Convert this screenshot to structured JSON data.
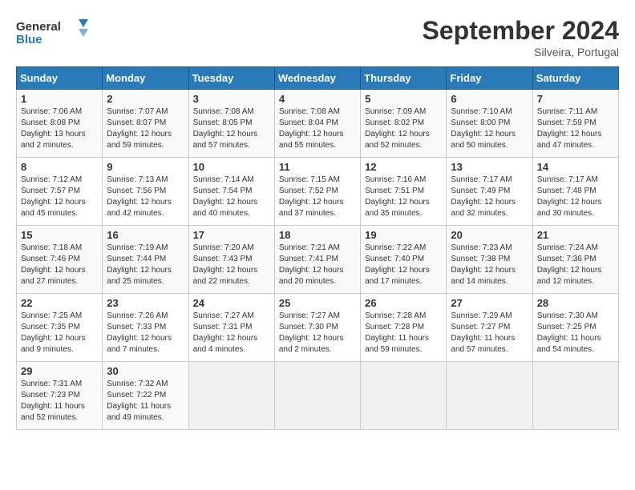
{
  "header": {
    "logo_general": "General",
    "logo_blue": "Blue",
    "month_title": "September 2024",
    "location": "Silveira, Portugal"
  },
  "weekdays": [
    "Sunday",
    "Monday",
    "Tuesday",
    "Wednesday",
    "Thursday",
    "Friday",
    "Saturday"
  ],
  "weeks": [
    [
      {
        "day": "1",
        "sunrise": "7:06 AM",
        "sunset": "8:08 PM",
        "daylight": "13 hours and 2 minutes."
      },
      {
        "day": "2",
        "sunrise": "7:07 AM",
        "sunset": "8:07 PM",
        "daylight": "12 hours and 59 minutes."
      },
      {
        "day": "3",
        "sunrise": "7:08 AM",
        "sunset": "8:05 PM",
        "daylight": "12 hours and 57 minutes."
      },
      {
        "day": "4",
        "sunrise": "7:08 AM",
        "sunset": "8:04 PM",
        "daylight": "12 hours and 55 minutes."
      },
      {
        "day": "5",
        "sunrise": "7:09 AM",
        "sunset": "8:02 PM",
        "daylight": "12 hours and 52 minutes."
      },
      {
        "day": "6",
        "sunrise": "7:10 AM",
        "sunset": "8:00 PM",
        "daylight": "12 hours and 50 minutes."
      },
      {
        "day": "7",
        "sunrise": "7:11 AM",
        "sunset": "7:59 PM",
        "daylight": "12 hours and 47 minutes."
      }
    ],
    [
      {
        "day": "8",
        "sunrise": "7:12 AM",
        "sunset": "7:57 PM",
        "daylight": "12 hours and 45 minutes."
      },
      {
        "day": "9",
        "sunrise": "7:13 AM",
        "sunset": "7:56 PM",
        "daylight": "12 hours and 42 minutes."
      },
      {
        "day": "10",
        "sunrise": "7:14 AM",
        "sunset": "7:54 PM",
        "daylight": "12 hours and 40 minutes."
      },
      {
        "day": "11",
        "sunrise": "7:15 AM",
        "sunset": "7:52 PM",
        "daylight": "12 hours and 37 minutes."
      },
      {
        "day": "12",
        "sunrise": "7:16 AM",
        "sunset": "7:51 PM",
        "daylight": "12 hours and 35 minutes."
      },
      {
        "day": "13",
        "sunrise": "7:17 AM",
        "sunset": "7:49 PM",
        "daylight": "12 hours and 32 minutes."
      },
      {
        "day": "14",
        "sunrise": "7:17 AM",
        "sunset": "7:48 PM",
        "daylight": "12 hours and 30 minutes."
      }
    ],
    [
      {
        "day": "15",
        "sunrise": "7:18 AM",
        "sunset": "7:46 PM",
        "daylight": "12 hours and 27 minutes."
      },
      {
        "day": "16",
        "sunrise": "7:19 AM",
        "sunset": "7:44 PM",
        "daylight": "12 hours and 25 minutes."
      },
      {
        "day": "17",
        "sunrise": "7:20 AM",
        "sunset": "7:43 PM",
        "daylight": "12 hours and 22 minutes."
      },
      {
        "day": "18",
        "sunrise": "7:21 AM",
        "sunset": "7:41 PM",
        "daylight": "12 hours and 20 minutes."
      },
      {
        "day": "19",
        "sunrise": "7:22 AM",
        "sunset": "7:40 PM",
        "daylight": "12 hours and 17 minutes."
      },
      {
        "day": "20",
        "sunrise": "7:23 AM",
        "sunset": "7:38 PM",
        "daylight": "12 hours and 14 minutes."
      },
      {
        "day": "21",
        "sunrise": "7:24 AM",
        "sunset": "7:36 PM",
        "daylight": "12 hours and 12 minutes."
      }
    ],
    [
      {
        "day": "22",
        "sunrise": "7:25 AM",
        "sunset": "7:35 PM",
        "daylight": "12 hours and 9 minutes."
      },
      {
        "day": "23",
        "sunrise": "7:26 AM",
        "sunset": "7:33 PM",
        "daylight": "12 hours and 7 minutes."
      },
      {
        "day": "24",
        "sunrise": "7:27 AM",
        "sunset": "7:31 PM",
        "daylight": "12 hours and 4 minutes."
      },
      {
        "day": "25",
        "sunrise": "7:27 AM",
        "sunset": "7:30 PM",
        "daylight": "12 hours and 2 minutes."
      },
      {
        "day": "26",
        "sunrise": "7:28 AM",
        "sunset": "7:28 PM",
        "daylight": "11 hours and 59 minutes."
      },
      {
        "day": "27",
        "sunrise": "7:29 AM",
        "sunset": "7:27 PM",
        "daylight": "11 hours and 57 minutes."
      },
      {
        "day": "28",
        "sunrise": "7:30 AM",
        "sunset": "7:25 PM",
        "daylight": "11 hours and 54 minutes."
      }
    ],
    [
      {
        "day": "29",
        "sunrise": "7:31 AM",
        "sunset": "7:23 PM",
        "daylight": "11 hours and 52 minutes."
      },
      {
        "day": "30",
        "sunrise": "7:32 AM",
        "sunset": "7:22 PM",
        "daylight": "11 hours and 49 minutes."
      },
      null,
      null,
      null,
      null,
      null
    ]
  ]
}
